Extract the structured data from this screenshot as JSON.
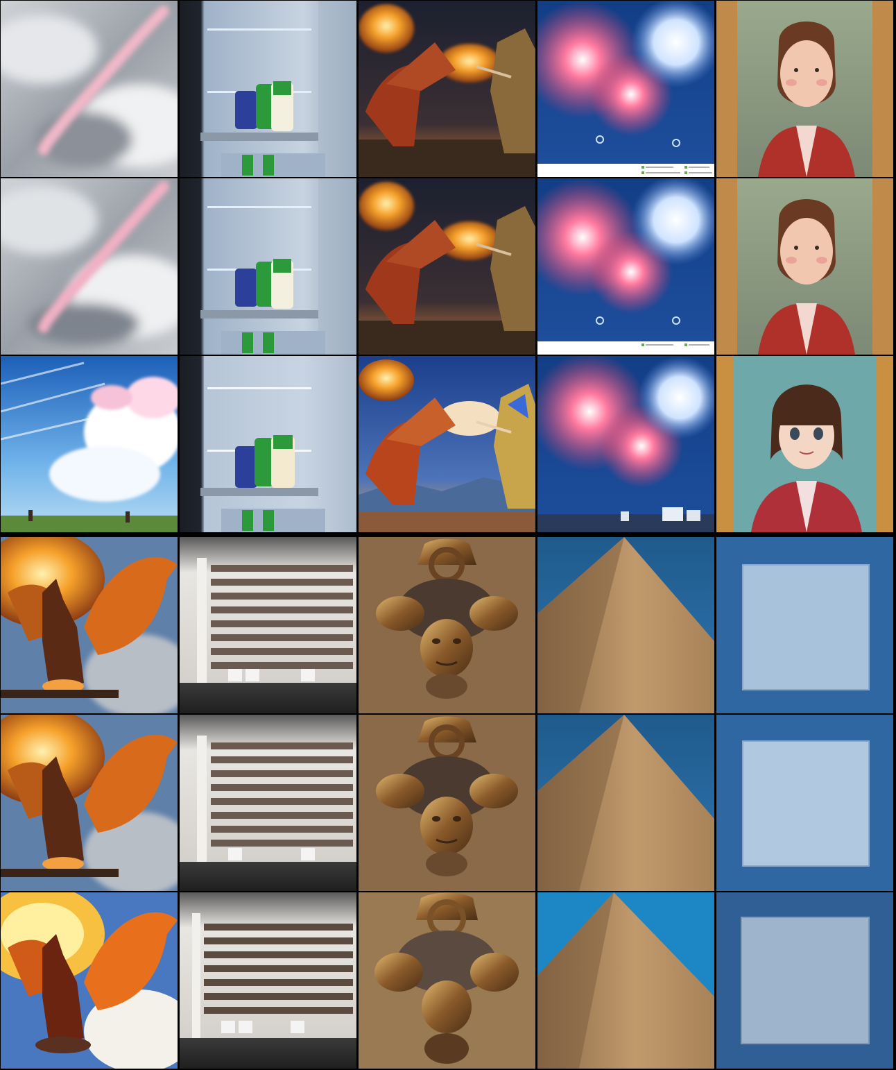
{
  "grid": {
    "columns": 5,
    "rows": 6,
    "groups": [
      {
        "group": "top",
        "columns": [
          {
            "subject": "pink-streak-cloudy-sky",
            "variants": [
              "blurred-gray",
              "blurred-gray-2",
              "anime-blue-sky"
            ]
          },
          {
            "subject": "open-refrigerator-bottles",
            "variants": [
              "photo-dark",
              "photo-dark-2",
              "photo-bright"
            ]
          },
          {
            "subject": "dragon-fighting-knight-fire",
            "variants": [
              "painting-dark",
              "painting-dark-2",
              "anime-bright"
            ]
          },
          {
            "subject": "red-blue-fireworks",
            "variants": [
              "photo-with-caption",
              "photo-with-caption-2",
              "photo-with-city"
            ]
          },
          {
            "subject": "girl-portrait-red-dress",
            "variants": [
              "oil-painting",
              "oil-painting-2",
              "anime-style"
            ]
          }
        ]
      },
      {
        "group": "bottom",
        "columns": [
          {
            "subject": "winged-dragon-flames",
            "variants": [
              "painting",
              "painting-2",
              "stylized"
            ]
          },
          {
            "subject": "library-bookshelves",
            "variants": [
              "photo-gray",
              "photo-gray-2",
              "photo-sharp"
            ]
          },
          {
            "subject": "brass-door-knocker-face",
            "variants": [
              "photo",
              "photo-2",
              "photo-sharp"
            ]
          },
          {
            "subject": "pyramid-blue-sky",
            "variants": [
              "photo",
              "photo-2",
              "photo-sharp"
            ]
          },
          {
            "subject": "paper-square-on-blue",
            "variants": [
              "photo",
              "photo-2",
              "photo-noisy"
            ]
          }
        ]
      }
    ]
  },
  "colors": {
    "background": "#000000",
    "sky_blue": "#2f6fb0",
    "fire_orange": "#f08020",
    "firework_pink": "#e8406a",
    "pyramid_sand": "#b08a60",
    "paper_blue": "#2e67a2"
  }
}
